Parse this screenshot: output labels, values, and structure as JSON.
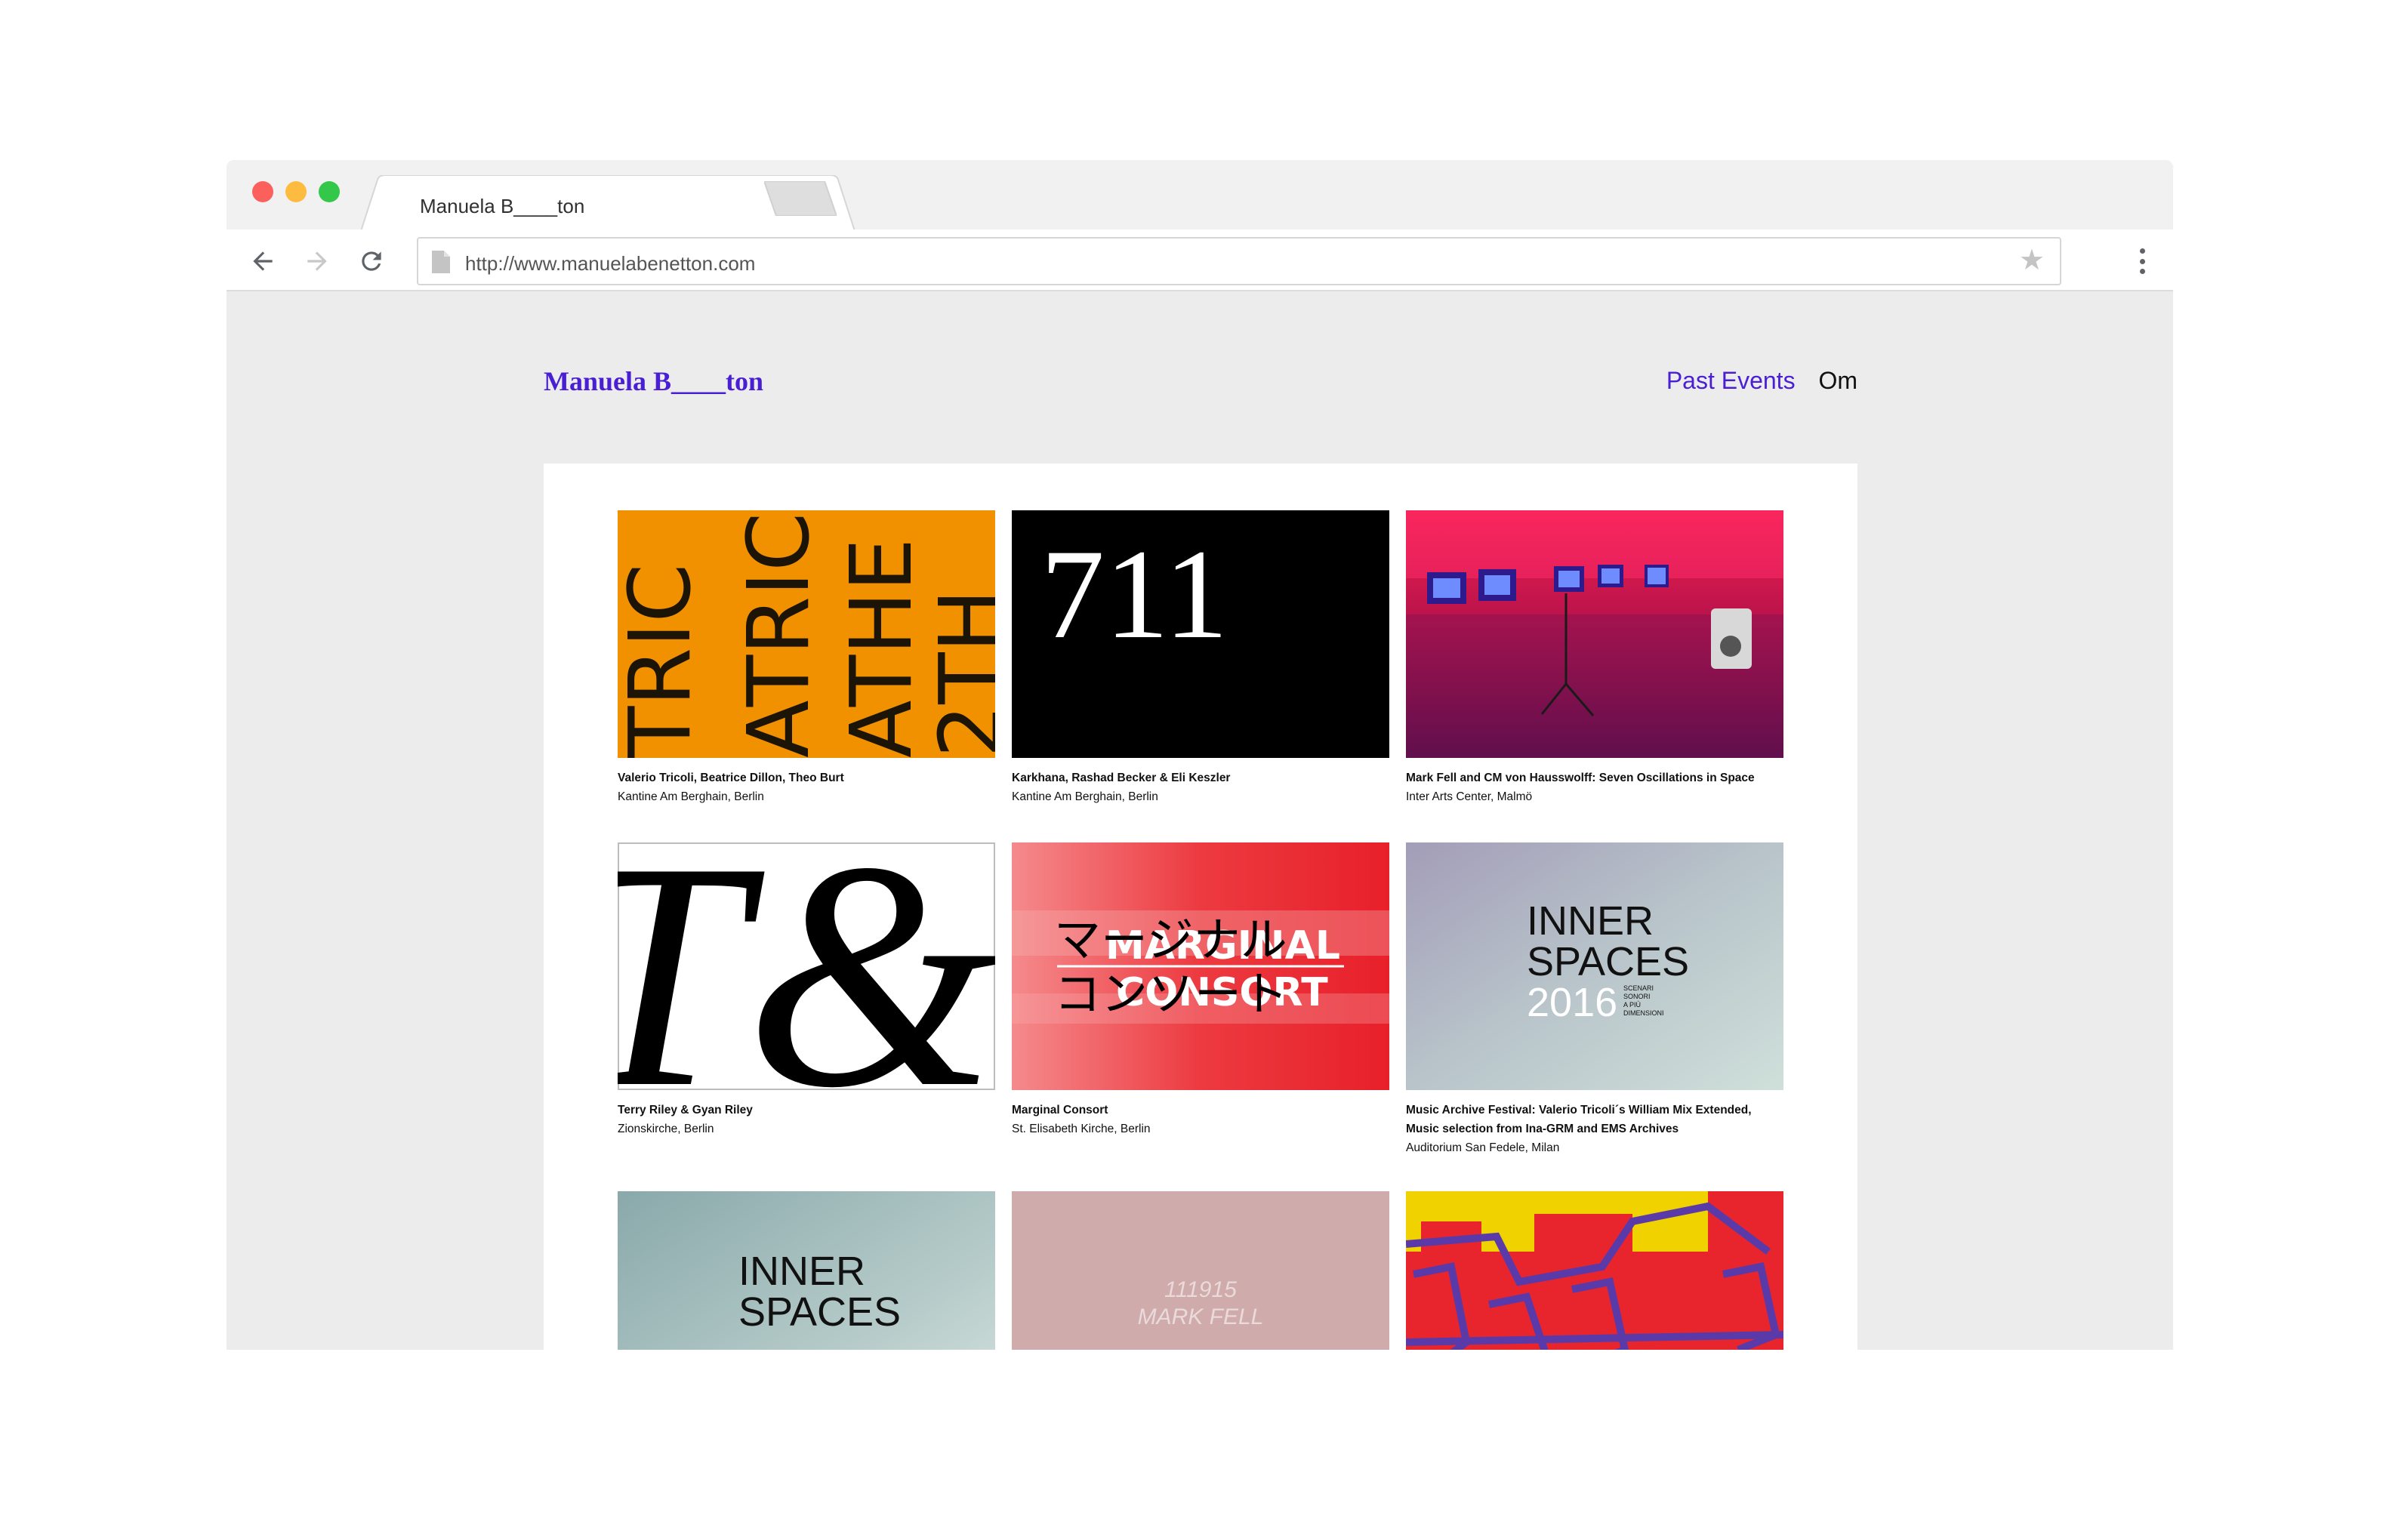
{
  "browser": {
    "tab_title": "Manuela B____ton",
    "tab_close": "×",
    "url": "http://www.manuelabenetton.com",
    "star": "★"
  },
  "site": {
    "logo": "Manuela B____ton",
    "nav": {
      "past_events": "Past Events",
      "om": "Om"
    }
  },
  "colors": {
    "accent": "#4a1fd4",
    "orange": "#f29100",
    "red": "#e8202a",
    "yellow": "#efd200"
  },
  "events": [
    {
      "title": "Valerio Tricoli, Beatrice Dillon, Theo Burt",
      "venue": "Kantine Am Berghain, Berlin",
      "artwork_text": [
        "TRIC",
        "ATRIC",
        "ATHE",
        "2TH"
      ]
    },
    {
      "title": "Karkhana, Rashad Becker & Eli Keszler",
      "venue": "Kantine Am Berghain, Berlin",
      "artwork_text": [
        "711"
      ]
    },
    {
      "title": "Mark Fell and CM von Hausswolff: Seven Oscillations in Space",
      "venue": "Inter Arts Center, Malmö"
    },
    {
      "title": "Terry Riley & Gyan Riley",
      "venue": "Zionskirche, Berlin",
      "artwork_text": [
        "T&"
      ]
    },
    {
      "title": "Marginal Consort",
      "venue": "St. Elisabeth Kirche, Berlin",
      "artwork_text": [
        "MARGINAL",
        "CONSORT",
        "マージナル",
        "コンソート"
      ]
    },
    {
      "title": "Music Archive Festival: Valerio Tricoli´s William Mix Extended,",
      "title_line2": "Music selection from Ina-GRM and EMS Archives",
      "venue": "Auditorium San Fedele, Milan",
      "artwork_text": [
        "INNER",
        "SPACES",
        "2016",
        "SCENARI",
        "SONORI",
        "A PIÙ",
        "DIMENSIONI"
      ]
    },
    {
      "title": "",
      "venue": "",
      "artwork_text": [
        "INNER",
        "SPACES"
      ]
    },
    {
      "title": "",
      "venue": "",
      "artwork_text": [
        "111915",
        "MARK FELL"
      ]
    },
    {
      "title": "",
      "venue": ""
    }
  ]
}
